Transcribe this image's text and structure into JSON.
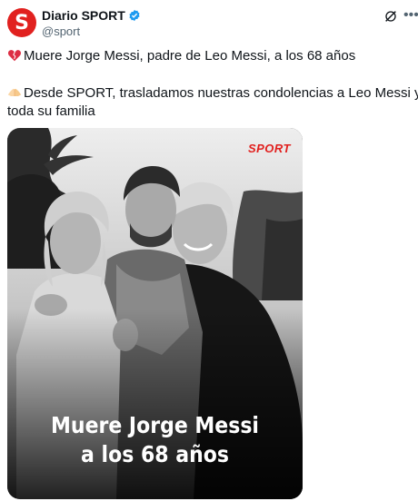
{
  "post": {
    "author": {
      "display_name": "Diario SPORT",
      "handle": "@sport",
      "avatar_letter": "S",
      "verified": true
    },
    "text_line1": "Muere Jorge Messi, padre de Leo Messi, a los 68 años",
    "text_line2": "Desde SPORT, trasladamos nuestras condolencias a Leo Messi y a",
    "text_line3": "toda su familia",
    "icons": [
      "broken-heart-icon",
      "folded-hands-icon",
      "grok-icon",
      "more-icon",
      "verified-badge-icon"
    ],
    "media": {
      "logo": "SPORT",
      "headline_line1": "Muere Jorge Messi",
      "headline_line2": "a los 68 años"
    }
  },
  "colors": {
    "brand": "#e1211f",
    "verified": "#1d9bf0",
    "secondary_text": "#536471"
  }
}
